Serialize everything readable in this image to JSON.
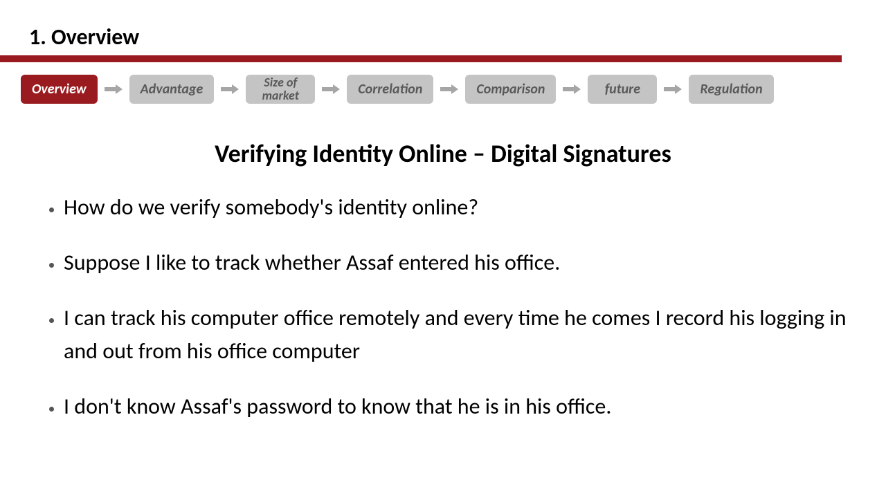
{
  "header": {
    "section_title": "1. Overview"
  },
  "breadcrumb": {
    "items": [
      {
        "label": "Overview",
        "active": true
      },
      {
        "label": "Advantage",
        "active": false
      },
      {
        "label": "Size of market",
        "active": false,
        "twoLine": true
      },
      {
        "label": "Correlation",
        "active": false
      },
      {
        "label": "Comparison",
        "active": false
      },
      {
        "label": "future",
        "active": false
      },
      {
        "label": "Regulation",
        "active": false
      }
    ]
  },
  "content": {
    "title": "Verifying Identity Online – Digital Signatures",
    "bullets": [
      "How do we verify somebody's identity online?",
      "Suppose I like to track whether Assaf entered his office.",
      "I can track his computer office remotely and every time he comes I record his logging in and out from his office computer",
      "I don't know Assaf's password to know that he is in his office."
    ]
  }
}
